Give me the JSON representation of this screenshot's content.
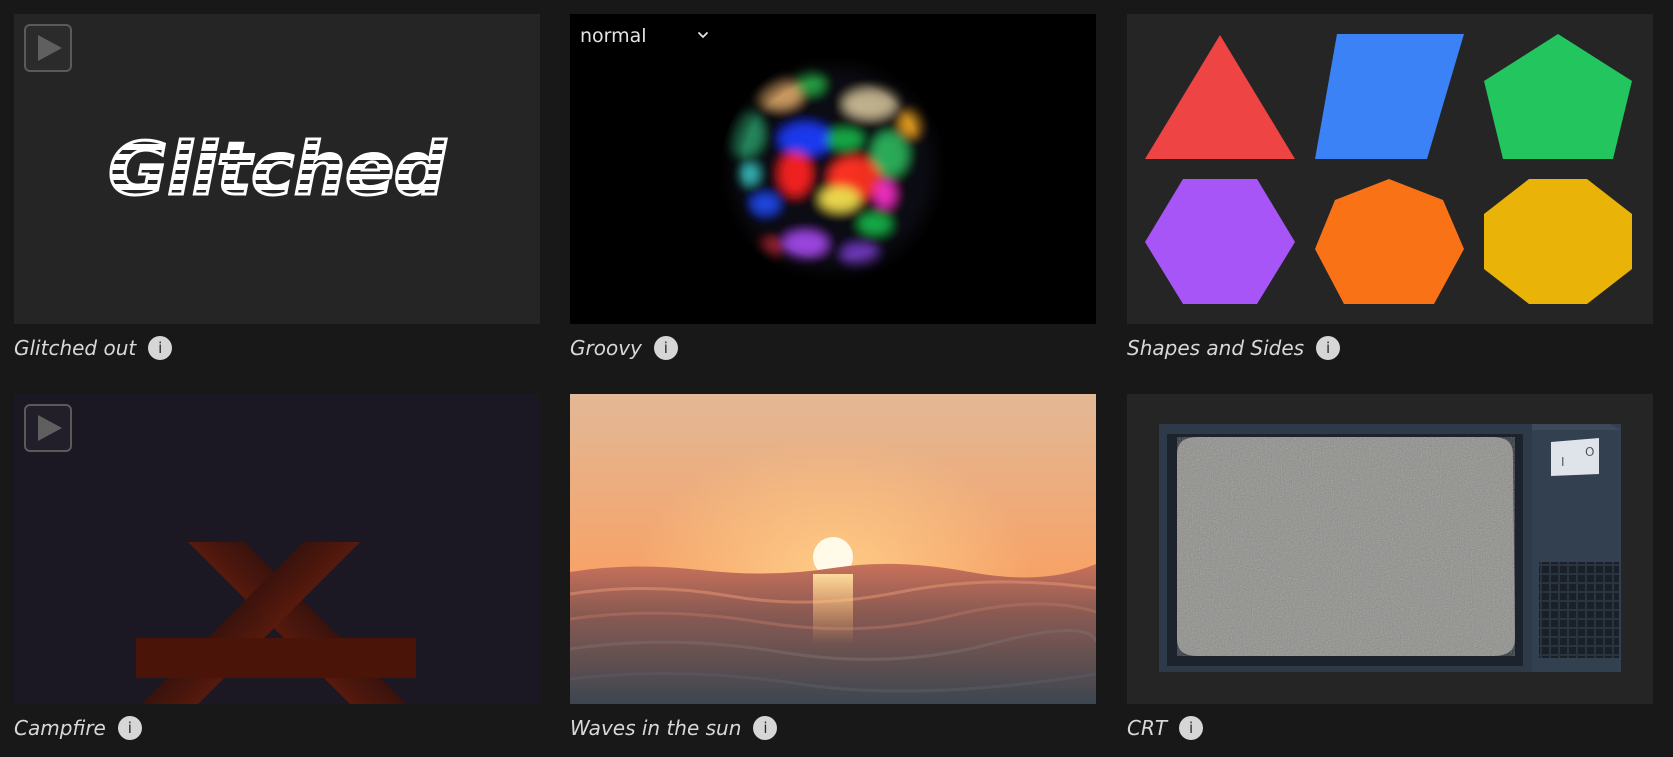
{
  "gallery": {
    "items": [
      {
        "caption": "Glitched out",
        "info_label": "i",
        "thumb_text": "Glitched",
        "thumb_icon": "play-icon"
      },
      {
        "caption": "Groovy",
        "info_label": "i",
        "mode_select": {
          "value": "normal",
          "options": [
            "normal"
          ]
        }
      },
      {
        "caption": "Shapes and Sides",
        "info_label": "i",
        "shape_colors": [
          "#ef4444",
          "#3b82f6",
          "#22c55e",
          "#a855f7",
          "#f97316",
          "#eab308"
        ]
      },
      {
        "caption": "Campfire",
        "info_label": "i",
        "thumb_icon": "play-icon"
      },
      {
        "caption": "Waves in the sun",
        "info_label": "i"
      },
      {
        "caption": "CRT",
        "info_label": "i",
        "switch_labels": [
          "I",
          "O"
        ]
      }
    ]
  },
  "colors": {
    "page_background": "#181818",
    "card_background": "#252525",
    "caption_text": "#d8d8d8"
  }
}
